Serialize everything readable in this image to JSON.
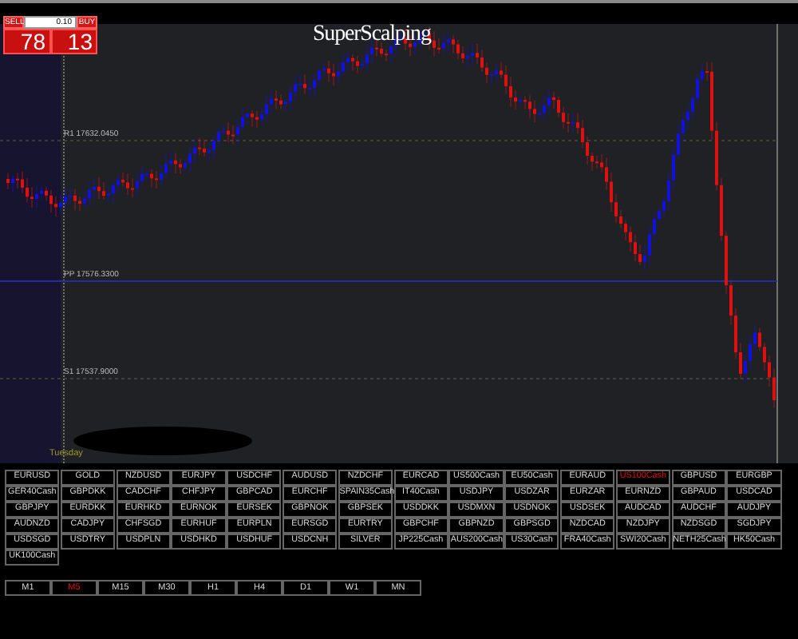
{
  "trade_panel": {
    "sell_label": "SELL",
    "buy_label": "BUY",
    "lot_value": "0.10",
    "sell_price": "78",
    "buy_price": "13"
  },
  "indicator_title": "SuperScalping",
  "levels": [
    {
      "label": "R1  17632.0450",
      "kind": "dashed"
    },
    {
      "label": "PP  17576.3300",
      "kind": "solid"
    },
    {
      "label": "S1  17537.9000",
      "kind": "dashed"
    }
  ],
  "session_label": "Tuesday",
  "symbols": [
    {
      "label": "EURUSD",
      "selected": false
    },
    {
      "label": "GOLD",
      "selected": false
    },
    {
      "label": "NZDUSD",
      "selected": false
    },
    {
      "label": "EURJPY",
      "selected": false
    },
    {
      "label": "USDCHF",
      "selected": false
    },
    {
      "label": "AUDUSD",
      "selected": false
    },
    {
      "label": "NZDCHF",
      "selected": false
    },
    {
      "label": "EURCAD",
      "selected": false
    },
    {
      "label": "US500Cash",
      "selected": false
    },
    {
      "label": "EU50Cash",
      "selected": false
    },
    {
      "label": "EURAUD",
      "selected": false
    },
    {
      "label": "US100Cash",
      "selected": true
    },
    {
      "label": "GBPUSD",
      "selected": false
    },
    {
      "label": "EURGBP",
      "selected": false
    },
    {
      "label": "GER40Cash",
      "selected": false
    },
    {
      "label": "GBPDKK",
      "selected": false
    },
    {
      "label": "CADCHF",
      "selected": false
    },
    {
      "label": "CHFJPY",
      "selected": false
    },
    {
      "label": "GBPCAD",
      "selected": false
    },
    {
      "label": "EURCHF",
      "selected": false
    },
    {
      "label": "SPAIN35Cash",
      "selected": false
    },
    {
      "label": "IT40Cash",
      "selected": false
    },
    {
      "label": "USDJPY",
      "selected": false
    },
    {
      "label": "USDZAR",
      "selected": false
    },
    {
      "label": "EURZAR",
      "selected": false
    },
    {
      "label": "EURNZD",
      "selected": false
    },
    {
      "label": "GBPAUD",
      "selected": false
    },
    {
      "label": "USDCAD",
      "selected": false
    },
    {
      "label": "GBPJPY",
      "selected": false
    },
    {
      "label": "EURDKK",
      "selected": false
    },
    {
      "label": "EURHKD",
      "selected": false
    },
    {
      "label": "EURNOK",
      "selected": false
    },
    {
      "label": "EURSEK",
      "selected": false
    },
    {
      "label": "GBPNOK",
      "selected": false
    },
    {
      "label": "GBPSEK",
      "selected": false
    },
    {
      "label": "USDDKK",
      "selected": false
    },
    {
      "label": "USDMXN",
      "selected": false
    },
    {
      "label": "USDNOK",
      "selected": false
    },
    {
      "label": "USDSEK",
      "selected": false
    },
    {
      "label": "AUDCAD",
      "selected": false
    },
    {
      "label": "AUDCHF",
      "selected": false
    },
    {
      "label": "AUDJPY",
      "selected": false
    },
    {
      "label": "AUDNZD",
      "selected": false
    },
    {
      "label": "CADJPY",
      "selected": false
    },
    {
      "label": "CHFSGD",
      "selected": false
    },
    {
      "label": "EURHUF",
      "selected": false
    },
    {
      "label": "EURPLN",
      "selected": false
    },
    {
      "label": "EURSGD",
      "selected": false
    },
    {
      "label": "EURTRY",
      "selected": false
    },
    {
      "label": "GBPCHF",
      "selected": false
    },
    {
      "label": "GBPNZD",
      "selected": false
    },
    {
      "label": "GBPSGD",
      "selected": false
    },
    {
      "label": "NZDCAD",
      "selected": false
    },
    {
      "label": "NZDJPY",
      "selected": false
    },
    {
      "label": "NZDSGD",
      "selected": false
    },
    {
      "label": "SGDJPY",
      "selected": false
    },
    {
      "label": "USDSGD",
      "selected": false
    },
    {
      "label": "USDTRY",
      "selected": false
    },
    {
      "label": "USDPLN",
      "selected": false
    },
    {
      "label": "USDHKD",
      "selected": false
    },
    {
      "label": "USDHUF",
      "selected": false
    },
    {
      "label": "USDCNH",
      "selected": false
    },
    {
      "label": "SILVER",
      "selected": false
    },
    {
      "label": "JP225Cash",
      "selected": false
    },
    {
      "label": "AUS200Cash",
      "selected": false
    },
    {
      "label": "US30Cash",
      "selected": false
    },
    {
      "label": "FRA40Cash",
      "selected": false
    },
    {
      "label": "SWI20Cash",
      "selected": false
    },
    {
      "label": "NETH25Cash",
      "selected": false
    },
    {
      "label": "HK50Cash",
      "selected": false
    },
    {
      "label": "UK100Cash",
      "selected": false
    }
  ],
  "timeframes": [
    {
      "label": "M1",
      "selected": false
    },
    {
      "label": "M5",
      "selected": true
    },
    {
      "label": "M15",
      "selected": false
    },
    {
      "label": "M30",
      "selected": false
    },
    {
      "label": "H1",
      "selected": false
    },
    {
      "label": "H4",
      "selected": false
    },
    {
      "label": "D1",
      "selected": false
    },
    {
      "label": "W1",
      "selected": false
    },
    {
      "label": "MN",
      "selected": false
    }
  ]
}
